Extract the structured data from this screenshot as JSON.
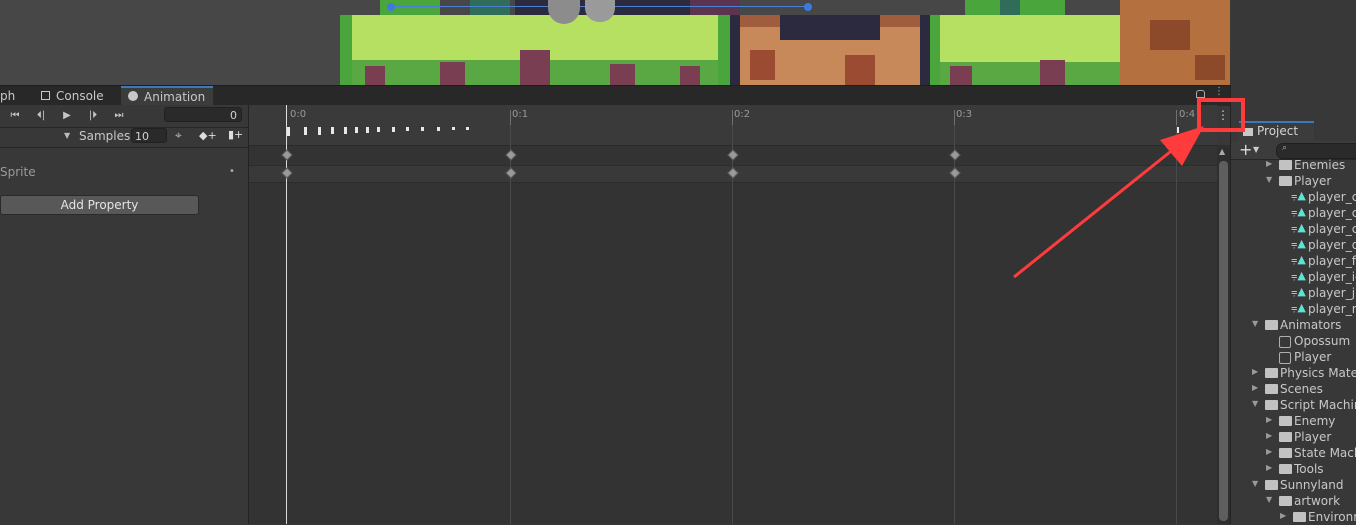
{
  "tabs": {
    "graph": "ph",
    "console": "Console",
    "animation": "Animation"
  },
  "controls": {
    "frame_value": "0",
    "samples_label": "Samples",
    "samples_value": "10",
    "property_name": "Sprite",
    "add_property_label": "Add Property"
  },
  "timeline": {
    "labels": [
      "0:0",
      "0:1",
      "0:2",
      "0:3",
      "0:4"
    ]
  },
  "project": {
    "title": "Project",
    "items": [
      {
        "label": "Enemies"
      },
      {
        "label": "Player"
      },
      {
        "label": "player_c"
      },
      {
        "label": "player_c"
      },
      {
        "label": "player_c"
      },
      {
        "label": "player_d"
      },
      {
        "label": "player_fa"
      },
      {
        "label": "player_id"
      },
      {
        "label": "player_ju"
      },
      {
        "label": "player_ru"
      },
      {
        "label": "Animators"
      },
      {
        "label": "Opossum"
      },
      {
        "label": "Player"
      },
      {
        "label": "Physics Mate"
      },
      {
        "label": "Scenes"
      },
      {
        "label": "Script Machin"
      },
      {
        "label": "Enemy"
      },
      {
        "label": "Player"
      },
      {
        "label": "State Mach"
      },
      {
        "label": "Tools"
      },
      {
        "label": "Sunnyland"
      },
      {
        "label": "artwork"
      },
      {
        "label": "Environm"
      }
    ]
  },
  "colors": {
    "accent": "#3a79bb",
    "highlight": "#ff3b3b",
    "grass_light": "#b5e061",
    "grass_dark": "#4aa63c"
  }
}
